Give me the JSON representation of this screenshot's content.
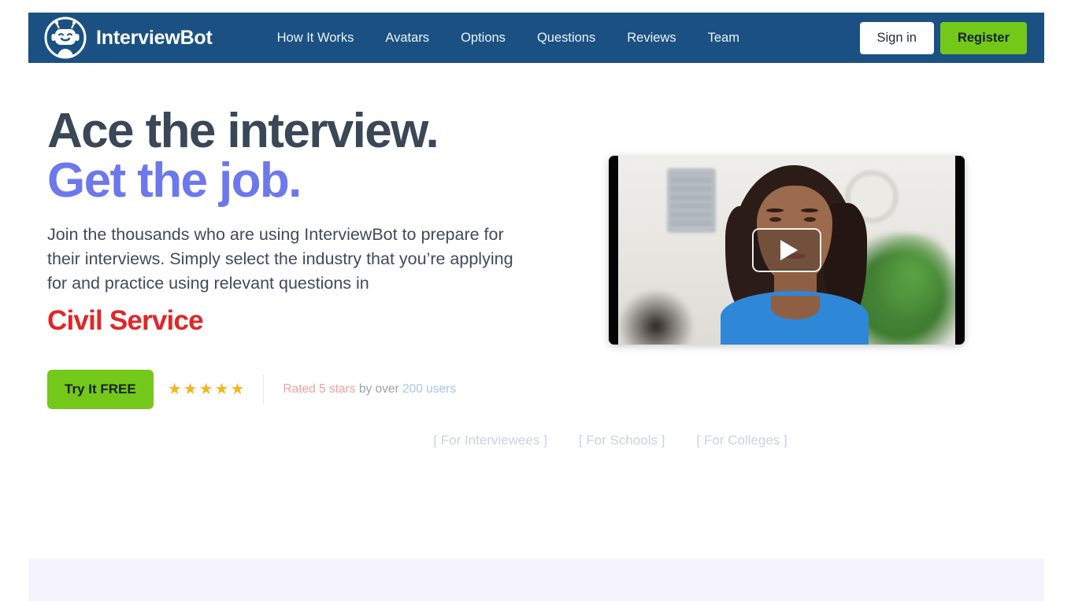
{
  "header": {
    "brand_name": "InterviewBot",
    "logo_icon": "robot-head-icon",
    "background_color": "#1a5182",
    "nav_items": [
      {
        "label": "How It Works"
      },
      {
        "label": "Avatars"
      },
      {
        "label": "Options"
      },
      {
        "label": "Questions"
      },
      {
        "label": "Reviews"
      },
      {
        "label": "Team"
      }
    ],
    "sign_in_label": "Sign in",
    "register_label": "Register",
    "register_color": "#74c81a"
  },
  "hero": {
    "headline_line1": "Ace the interview.",
    "headline_line2": "Get the job.",
    "headline_line1_color": "#3a4757",
    "headline_line2_color": "#6c78ec",
    "paragraph": "Join the thousands who are using InterviewBot to prepare for their interviews. Simply select the industry that you’re applying for and practice using relevant questions in",
    "industry": "Civil Service",
    "industry_color": "#e22526",
    "cta_label": "Try It FREE",
    "cta_color": "#74c81a",
    "rating": {
      "stars_count": 5,
      "star_glyph": "★",
      "star_color": "#f6b422",
      "text_rated": "Rated 5 stars",
      "text_middle": " by over ",
      "text_users": "200 users"
    },
    "audience_links": [
      {
        "label": "[ For Interviewees ]"
      },
      {
        "label": "[ For Schools ]"
      },
      {
        "label": "[ For Colleges ]"
      }
    ]
  },
  "video": {
    "play_icon": "play-triangle-icon",
    "thumbnail_description": "Woman in blue sleeveless top seated in a bright room with a framed grid picture, a wall clock and a green plant",
    "letterbox_color": "#050505"
  },
  "bottom_band": {
    "background_color": "#f5f4fd"
  }
}
